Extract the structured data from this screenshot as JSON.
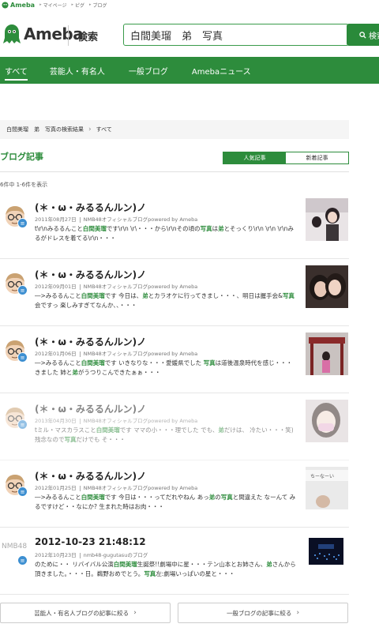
{
  "topbar": {
    "logo": "Ameba",
    "links": [
      "マイページ",
      "ピグ",
      "ブログ"
    ]
  },
  "header": {
    "brand": "Ameba",
    "kensaku": "検索",
    "search_value": "白間美瑠　弟　写真",
    "search_button": "検索"
  },
  "nav": {
    "tabs": [
      "すべて",
      "芸能人・有名人",
      "一般ブログ",
      "Amebaニュース"
    ]
  },
  "breadcrumb": {
    "current": "白間美瑠　弟　写真の検索結果",
    "next": "すべて"
  },
  "section": {
    "title": "ブログ記事",
    "toggle_popular": "人気記事",
    "toggle_new": "新着記事",
    "count": "6件中 1-6件を表示"
  },
  "results": [
    {
      "title": "(＊・ω・みるるんルン)ノ",
      "date": "2011年08月27日",
      "source": "NMB48オフィシャルブログpowered by Ameba",
      "snippet_html": "t\\r\\nみるるんこと<b>白間美瑠</b>です\\r\\n \\r\\・・・から\\r\\nその頃の<b>写真</b>は<b>弟</b>とそっくり\\r\\n \\r\\n \\r\\nみるがドレスを着てる\\r\\n・・・"
    },
    {
      "title": "(＊・ω・みるるんルン)ノ",
      "date": "2012年09月01日",
      "source": "NMB48オフィシャルブログpowered by Ameba",
      "snippet_html": "―>みるるんこと<b>白間美瑠</b>です 今日は、<b>弟</b>とカラオケに行ってきまし・・・、明日は握手会&amp;<b>写真</b>会ですっ 楽しみすぎてなんか、、・・・"
    },
    {
      "title": "(＊・ω・みるるんルン)ノ",
      "date": "2012年01月06日",
      "source": "NMB48オフィシャルブログpowered by Ameba",
      "snippet_html": "―>みるるんこと<b>白間美瑠</b>です いきなりな・・・愛媛県でした <b>写真</b>は道後温泉時代を感じ・・・きました 姉と<b>弟</b>がうつりこんできたぁぁ・・・"
    },
    {
      "title": "(＊・ω・みるるんルン)ノ",
      "date": "2013年04月30日",
      "source": "NMB48オフィシャルブログpowered by Ameba",
      "snippet_html": "tミル・マスカラスこと<b>白間美瑠</b>です ママの小・・・理でした でも、<b>弟</b>だけは、 冷たい・・・笑) 残念なので<b>写真</b>だけでも そ・・・"
    },
    {
      "title": "(＊・ω・みるるんルン)ノ",
      "date": "2012年01月25日",
      "source": "NMB48オフィシャルブログpowered by Ameba",
      "snippet_html": "―>みるるんこと<b>白間美瑠</b>です 今日は・・・ってだれやねん あっ<b>弟</b>の<b>写真</b>と間違えた なーんて みるですけど・・なにか? 生まれた時はお肉・・・"
    },
    {
      "title": "2012-10-23 21:48:12",
      "date": "2012年10月23日",
      "source": "nmb48-gugutasuのブログ",
      "snippet_html": "のために・・ リバイバル公演<b>白間美瑠</b>生誕祭!!劇場中に星・・・テン山本とお姉さん、<b>弟</b>さんから頂きました。・・・日。鵜野おめでとう。<b>写真</b>左:劇場いっぱいの星と・・・"
    }
  ],
  "nmb_logo": "NMB48",
  "bottom": {
    "left": "芸能人・有名人ブログの記事に絞る",
    "right": "一般ブログの記事に絞る"
  },
  "colors": {
    "accent": "#2d8c3c",
    "badge": "#3d8fd1"
  }
}
